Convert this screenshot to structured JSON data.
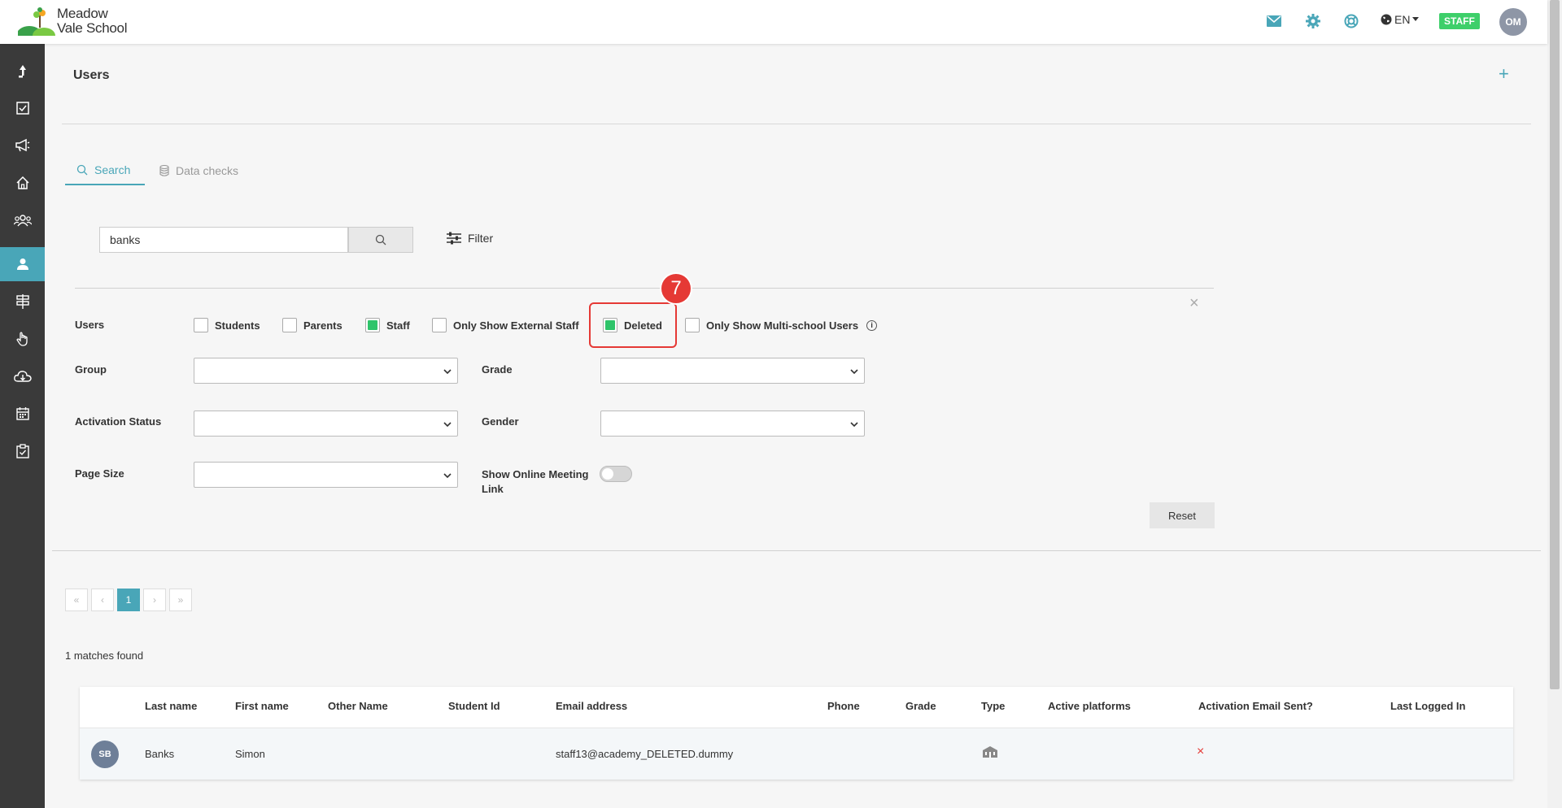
{
  "header": {
    "logo_line1": "Meadow",
    "logo_line2": "Vale School",
    "language": "EN",
    "role_badge": "STAFF",
    "user_initials": "OM",
    "icons": [
      "mail-icon",
      "gear-icon",
      "help-lifebuoy-icon",
      "globe-icon"
    ]
  },
  "sidebar": {
    "items": [
      "upload-icon",
      "checklist-icon",
      "megaphone-icon",
      "home-icon",
      "group-icon",
      "user-icon",
      "signpost-icon",
      "touch-icon",
      "cloud-download-icon",
      "calendar-icon",
      "clipboard-check-icon"
    ],
    "active_index": 5
  },
  "page": {
    "title": "Users",
    "add_label": "+"
  },
  "tabs": [
    {
      "label": "Search",
      "active": true
    },
    {
      "label": "Data checks",
      "active": false
    }
  ],
  "search": {
    "value": "banks",
    "filter_label": "Filter"
  },
  "filters": {
    "users_label": "Users",
    "checkboxes": [
      {
        "label": "Students",
        "checked": false
      },
      {
        "label": "Parents",
        "checked": false
      },
      {
        "label": "Staff",
        "checked": true
      },
      {
        "label": "Only Show External Staff",
        "checked": false
      },
      {
        "label": "Deleted",
        "checked": true
      },
      {
        "label": "Only Show Multi-school Users",
        "checked": false
      }
    ],
    "group_label": "Group",
    "grade_label": "Grade",
    "activation_label": "Activation Status",
    "gender_label": "Gender",
    "page_size_label": "Page Size",
    "online_meeting_label_1": "Show Online Meeting",
    "online_meeting_label_2": "Link",
    "online_meeting_enabled": false,
    "reset_label": "Reset",
    "close_label": "×"
  },
  "annotation": {
    "step_number": "7",
    "color": "#e53935"
  },
  "pagination": {
    "first": "«",
    "prev": "‹",
    "current": "1",
    "next": "›",
    "last": "»"
  },
  "results": {
    "summary": "1 matches found",
    "columns": [
      "Last name",
      "First name",
      "Other Name",
      "Student Id",
      "Email address",
      "Phone",
      "Grade",
      "Type",
      "Active platforms",
      "Activation Email Sent?",
      "Last Logged In"
    ],
    "rows": [
      {
        "initials": "SB",
        "last_name": "Banks",
        "first_name": "Simon",
        "other_name": "",
        "student_id": "",
        "email": "staff13@academy_DELETED.dummy",
        "phone": "",
        "grade": "",
        "type_icon": "school-building-icon",
        "active_platforms": "",
        "activation_email_sent": "×",
        "last_logged_in": ""
      }
    ]
  },
  "colors": {
    "accent": "#49a6b8",
    "sidebar": "#3a3a3a",
    "checkbox_checked": "#2ec46a",
    "staff_badge": "#3ecf6a"
  }
}
